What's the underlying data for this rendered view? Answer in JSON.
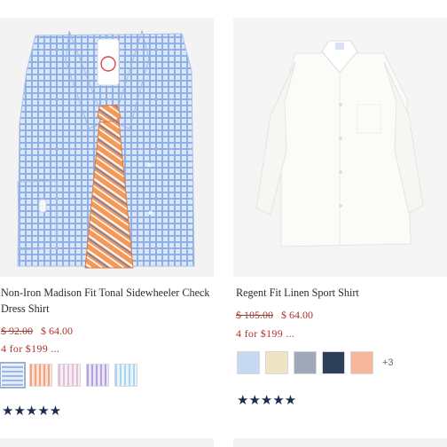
{
  "products": [
    {
      "name": "Non-Iron Madison Fit Tonal Sidewheeler Check Dress Shirt",
      "original_price": "$ 92.00",
      "sale_price": "$ 64.00",
      "promo": "4 for $199 ...",
      "rating_stars": "★★★★★",
      "rating": 5,
      "swatch_colors": [
        "#b7c8e8",
        "#f4b89a",
        "#e8d0e0",
        "#c9b8e8",
        "#c8e4f4"
      ],
      "selected_swatch": 0
    },
    {
      "name": "Regent Fit Linen Sport Shirt",
      "original_price": "$ 105.00",
      "sale_price": "$ 64.00",
      "promo": "4 for $199 ...",
      "rating_stars": "★★★★★",
      "rating": 5,
      "swatch_colors": [
        "#c7d9f0",
        "#efe3c6",
        "#9ea8b6",
        "#2e3f5a",
        "#f6b79c"
      ],
      "more_swatches": "+3"
    }
  ]
}
